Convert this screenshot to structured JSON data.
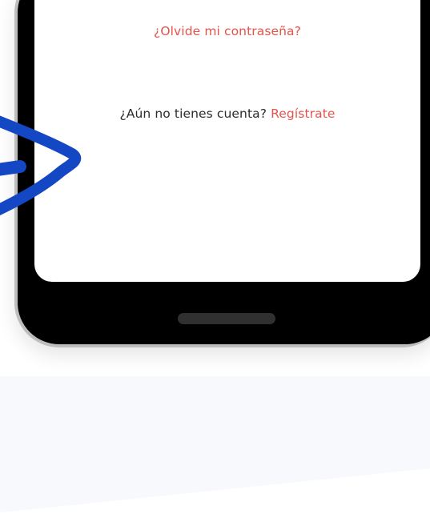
{
  "screen": {
    "forgot_password_link": "¿Olvide mi contraseña?",
    "signup_prompt": "¿Aún no tienes cuenta?",
    "signup_link": "Regístrate"
  },
  "colors": {
    "accent": "#e5534b",
    "text": "#2b2b2b",
    "annotation_arrow": "#1447c4",
    "phone_body": "#000000",
    "phone_frame": "#bdbdbd"
  },
  "annotation": {
    "icon": "arrow-pointer-icon"
  }
}
